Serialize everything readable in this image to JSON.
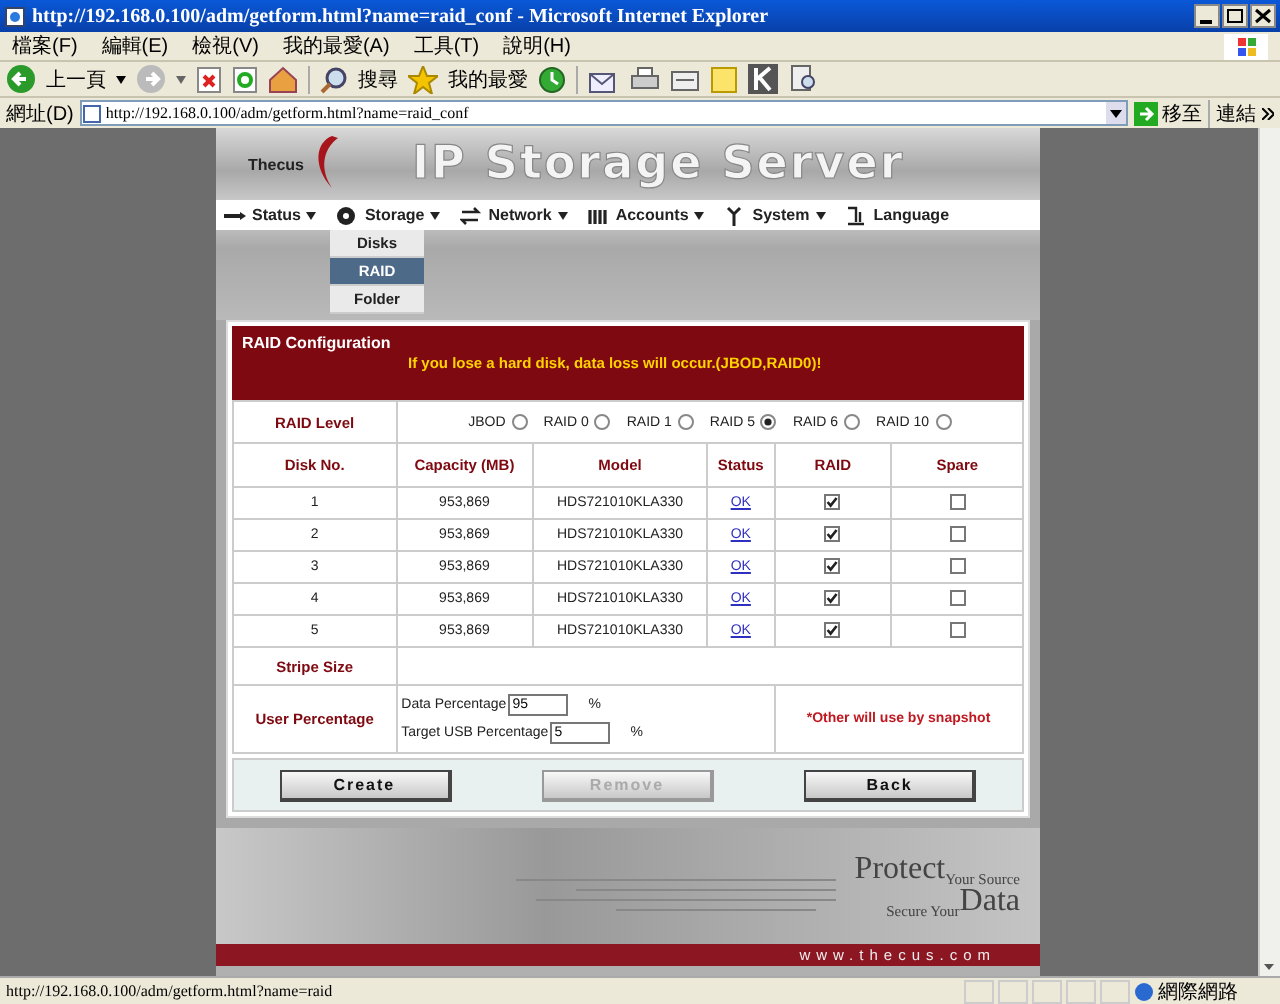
{
  "window": {
    "title": "http://192.168.0.100/adm/getform.html?name=raid_conf - Microsoft Internet Explorer"
  },
  "menu_bar": [
    "檔案(F)",
    "編輯(E)",
    "檢視(V)",
    "我的最愛(A)",
    "工具(T)",
    "說明(H)"
  ],
  "toolbar": {
    "back": "上一頁",
    "search": "搜尋",
    "favorites": "我的最愛"
  },
  "address_bar": {
    "label": "網址(D)",
    "value": "http://192.168.0.100/adm/getform.html?name=raid_conf",
    "go": "移至",
    "links": "連結"
  },
  "page": {
    "logo": "Thecus",
    "banner": "IP Storage Server",
    "nav": [
      {
        "label": "Status",
        "kind": "menu"
      },
      {
        "label": "Storage",
        "kind": "menu"
      },
      {
        "label": "Network",
        "kind": "menu"
      },
      {
        "label": "Accounts",
        "kind": "menu"
      },
      {
        "label": "System",
        "kind": "menu"
      },
      {
        "label": "Language",
        "kind": "link"
      }
    ],
    "submenu": [
      {
        "label": "Disks",
        "selected": false
      },
      {
        "label": "RAID",
        "selected": true
      },
      {
        "label": "Folder",
        "selected": false
      }
    ],
    "raid": {
      "title": "RAID Configuration",
      "warning": "If you lose a hard disk, data loss will occur.(JBOD,RAID0)!",
      "level_label": "RAID Level",
      "levels": [
        {
          "label": "JBOD",
          "selected": false
        },
        {
          "label": "RAID 0",
          "selected": false
        },
        {
          "label": "RAID 1",
          "selected": false
        },
        {
          "label": "RAID 5",
          "selected": true
        },
        {
          "label": "RAID 6",
          "selected": false
        },
        {
          "label": "RAID 10",
          "selected": false
        }
      ],
      "columns": [
        "Disk No.",
        "Capacity (MB)",
        "Model",
        "Status",
        "RAID",
        "Spare"
      ],
      "disks": [
        {
          "number": "1",
          "capacity": "953,869",
          "model": "HDS721010KLA330",
          "status": "OK",
          "raid": true,
          "spare": false
        },
        {
          "number": "2",
          "capacity": "953,869",
          "model": "HDS721010KLA330",
          "status": "OK",
          "raid": true,
          "spare": false
        },
        {
          "number": "3",
          "capacity": "953,869",
          "model": "HDS721010KLA330",
          "status": "OK",
          "raid": true,
          "spare": false
        },
        {
          "number": "4",
          "capacity": "953,869",
          "model": "HDS721010KLA330",
          "status": "OK",
          "raid": true,
          "spare": false
        },
        {
          "number": "5",
          "capacity": "953,869",
          "model": "HDS721010KLA330",
          "status": "OK",
          "raid": true,
          "spare": false
        }
      ],
      "stripe_label": "Stripe Size",
      "user_label": "User Percentage",
      "data_label": "Data Percentage",
      "data_value": "95",
      "data_unit": "%",
      "usb_label": "Target USB Percentage",
      "usb_value": "5",
      "usb_unit": "%",
      "note": "*Other will use by snapshot",
      "buttons": [
        {
          "label": "Create",
          "disabled": false
        },
        {
          "label": "Remove",
          "disabled": true
        },
        {
          "label": "Back",
          "disabled": false
        }
      ]
    },
    "footer": {
      "protect": "Protect",
      "your_source": "Your Source",
      "secure_your": "Secure Your",
      "data": "Data",
      "url": "www.thecus.com"
    }
  },
  "status_bar": {
    "url": "http://192.168.0.100/adm/getform.html?name=raid",
    "zone": "網際網路"
  }
}
